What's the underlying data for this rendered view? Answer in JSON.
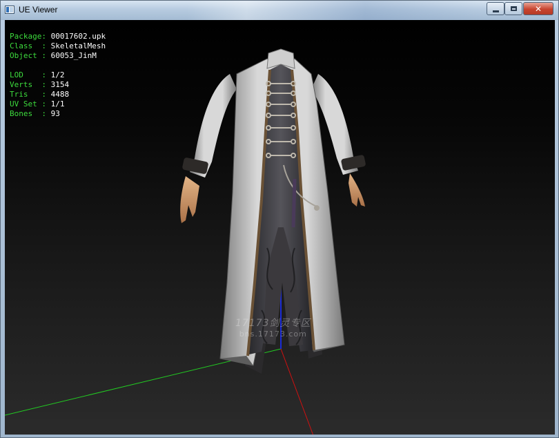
{
  "window": {
    "title": "UE Viewer",
    "controls": {
      "minimize": "minimize",
      "maximize": "maximize",
      "close": "✕"
    }
  },
  "info": [
    {
      "key": "Package",
      "sep": ": ",
      "value": "00017602.upk"
    },
    {
      "key": "Class  ",
      "sep": ": ",
      "value": "SkeletalMesh"
    },
    {
      "key": "Object ",
      "sep": ": ",
      "value": "60053_JinM"
    },
    {
      "spacer": true
    },
    {
      "key": "LOD    ",
      "sep": ": ",
      "value": "1/2"
    },
    {
      "key": "Verts  ",
      "sep": ": ",
      "value": "3154"
    },
    {
      "key": "Tris   ",
      "sep": ": ",
      "value": "4488"
    },
    {
      "key": "UV Set ",
      "sep": ": ",
      "value": "1/1"
    },
    {
      "key": "Bones  ",
      "sep": ": ",
      "value": "93"
    }
  ],
  "watermark": {
    "top": "17173剑灵专区",
    "bottom": "bns.17173.com"
  },
  "colors": {
    "info_key": "#3ddc3d",
    "info_value": "#ffffff",
    "axis_x": "#22cc22",
    "axis_y": "#d01010",
    "axis_z": "#1a2bd8"
  }
}
